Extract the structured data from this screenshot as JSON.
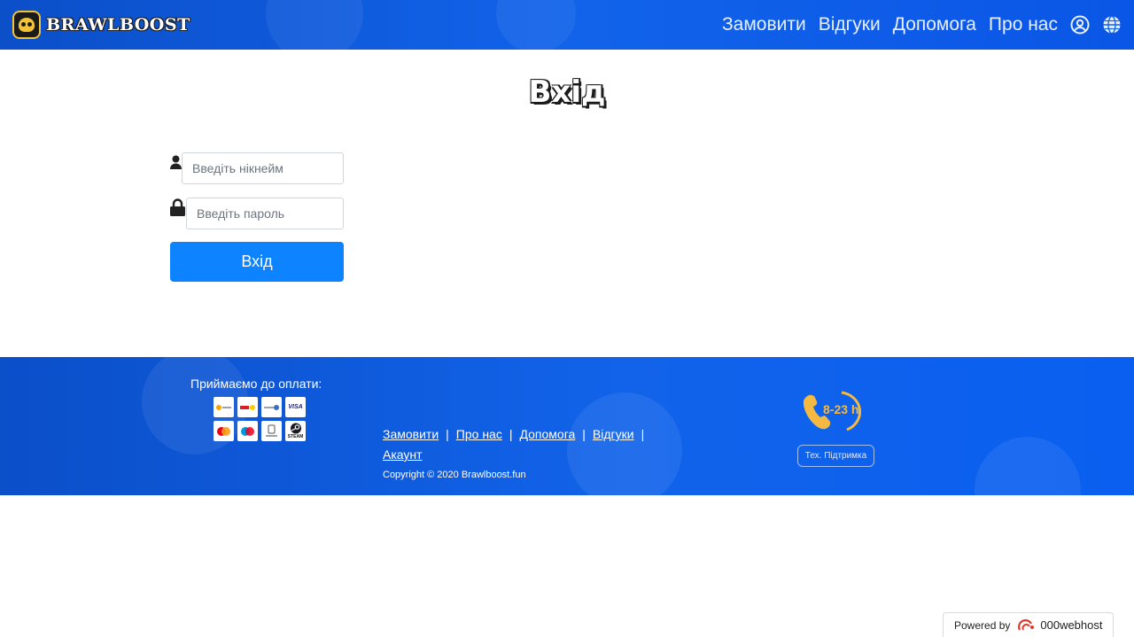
{
  "header": {
    "logo_text": "BRAWLBOOST",
    "nav": [
      {
        "label": "Замовити"
      },
      {
        "label": "Відгуки"
      },
      {
        "label": "Допомога"
      },
      {
        "label": "Про нас"
      }
    ],
    "icons": [
      "user-circle-icon",
      "globe-icon"
    ]
  },
  "login": {
    "title": "Вхід",
    "username_placeholder": "Введіть нікнейм",
    "username_value": "",
    "password_placeholder": "Введіть пароль",
    "password_value": "",
    "submit_label": "Вхід"
  },
  "footer": {
    "payment_title": "Приймаємо до оплати:",
    "payment_methods": [
      "visa-qiwi-icon",
      "yandex-money-icon",
      "webmoney-icon",
      "visa-icon",
      "mastercard-icon",
      "maestro-icon",
      "yandex-wallet-icon",
      "steam-icon"
    ],
    "payment_labels": [
      "VISA",
      "STEAM"
    ],
    "links": [
      {
        "label": "Замовити"
      },
      {
        "label": "Про нас"
      },
      {
        "label": "Допомога"
      },
      {
        "label": "Відгуки"
      },
      {
        "label": "Акаунт"
      }
    ],
    "separator": "|",
    "copyright": "Copyright © 2020 Brawlboost.fun",
    "hours": "8-23 h",
    "support_label": "Тех. Підтримка"
  },
  "powered_by": {
    "prefix": "Powered by",
    "brand": "000webhost"
  },
  "colors": {
    "header_blue": "#1263ea",
    "button_blue": "#0d83ff",
    "accent_orange": "#f4b942",
    "logo_gold": "#f2c335"
  }
}
